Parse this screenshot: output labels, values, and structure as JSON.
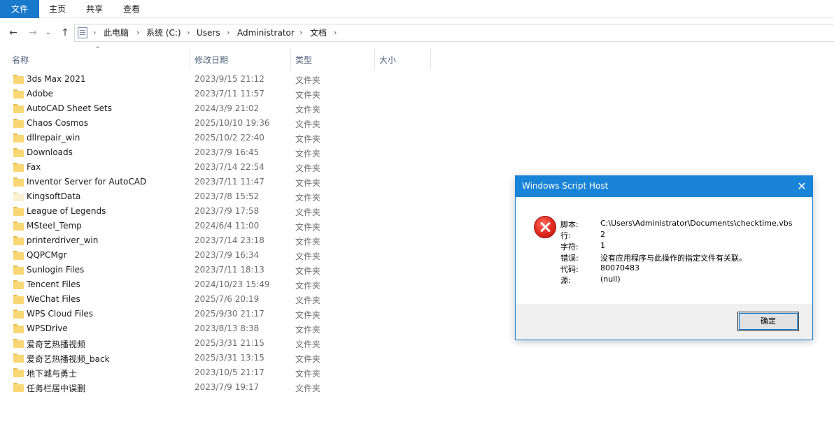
{
  "ribbon": {
    "tabs": [
      "文件",
      "主页",
      "共享",
      "查看"
    ]
  },
  "address": {
    "crumbs": [
      "此电脑",
      "系统 (C:)",
      "Users",
      "Administrator",
      "文档"
    ]
  },
  "columns": {
    "name": "名称",
    "modified": "修改日期",
    "type": "类型",
    "size": "大小"
  },
  "files": [
    {
      "name": "3ds Max 2021",
      "date": "2023/9/15 21:12",
      "type": "文件夹"
    },
    {
      "name": "Adobe",
      "date": "2023/7/11 11:57",
      "type": "文件夹"
    },
    {
      "name": "AutoCAD Sheet Sets",
      "date": "2024/3/9 21:02",
      "type": "文件夹"
    },
    {
      "name": "Chaos Cosmos",
      "date": "2025/10/10 19:36",
      "type": "文件夹"
    },
    {
      "name": "dllrepair_win",
      "date": "2025/10/2 22:40",
      "type": "文件夹"
    },
    {
      "name": "Downloads",
      "date": "2023/7/9 16:45",
      "type": "文件夹"
    },
    {
      "name": "Fax",
      "date": "2023/7/14 22:54",
      "type": "文件夹"
    },
    {
      "name": "Inventor Server for AutoCAD",
      "date": "2023/7/11 11:47",
      "type": "文件夹"
    },
    {
      "name": "KingsoftData",
      "date": "2023/7/8 15:52",
      "type": "文件夹"
    },
    {
      "name": "League of Legends",
      "date": "2023/7/9 17:58",
      "type": "文件夹"
    },
    {
      "name": "MSteel_Temp",
      "date": "2024/6/4 11:00",
      "type": "文件夹"
    },
    {
      "name": "printerdriver_win",
      "date": "2023/7/14 23:18",
      "type": "文件夹"
    },
    {
      "name": "QQPCMgr",
      "date": "2023/7/9 16:34",
      "type": "文件夹"
    },
    {
      "name": "Sunlogin Files",
      "date": "2023/7/11 18:13",
      "type": "文件夹"
    },
    {
      "name": "Tencent Files",
      "date": "2024/10/23 15:49",
      "type": "文件夹"
    },
    {
      "name": "WeChat Files",
      "date": "2025/7/6 20:19",
      "type": "文件夹"
    },
    {
      "name": "WPS Cloud Files",
      "date": "2025/9/30 21:17",
      "type": "文件夹"
    },
    {
      "name": "WPSDrive",
      "date": "2023/8/13 8:38",
      "type": "文件夹"
    },
    {
      "name": "爱奇艺热播视频",
      "date": "2025/3/31 21:15",
      "type": "文件夹"
    },
    {
      "name": "爱奇艺热播视频_back",
      "date": "2025/3/31 13:15",
      "type": "文件夹"
    },
    {
      "name": "地下城与勇士",
      "date": "2023/10/5 21:17",
      "type": "文件夹"
    },
    {
      "name": "任务栏居中误删",
      "date": "2023/7/9 19:17",
      "type": "文件夹"
    }
  ],
  "dialog": {
    "title": "Windows Script Host",
    "close_glyph": "✕",
    "icon": "error-icon",
    "fields": [
      {
        "key": "脚本:",
        "value": "C:\\Users\\Administrator\\Documents\\checktime.vbs"
      },
      {
        "key": "行:",
        "value": "2"
      },
      {
        "key": "字符:",
        "value": "1"
      },
      {
        "key": "错误:",
        "value": "没有应用程序与此操作的指定文件有关联。"
      },
      {
        "key": "代码:",
        "value": "80070483"
      },
      {
        "key": "源:",
        "value": "(null)"
      }
    ],
    "ok_label": "确定"
  },
  "colors": {
    "accent": "#1979ca",
    "dialog_title": "#1883d7",
    "folder": "#f8d775"
  }
}
